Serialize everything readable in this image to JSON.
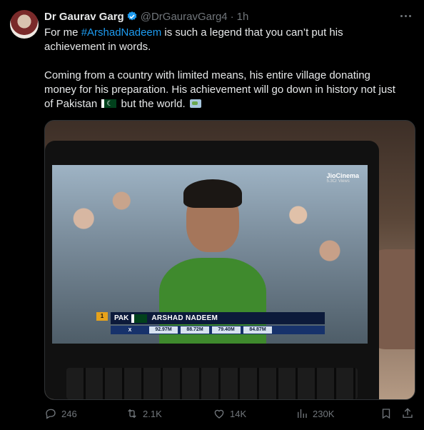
{
  "author": {
    "name": "Dr Gaurav Garg",
    "handle": "@DrGauravGarg4",
    "time": "1h"
  },
  "tweet": {
    "line1_before": "For me ",
    "hashtag": "#ArshadNadeem",
    "line1_after": " is such a legend that you can’t put his achievement in words.",
    "para2_before": "Coming from a country with limited means, his entire village donating money for his preparation. His achievement will go down in history not just of Pakistan ",
    "para2_mid": " but the world. "
  },
  "media": {
    "broadcaster": "JioCinema",
    "broadcaster_sub": "5.3Cr Views",
    "rank": "1",
    "country_code": "PAK",
    "athlete_name": "ARSHAD NADEEM",
    "scores": [
      "X",
      "92.97M",
      "88.72M",
      "79.40M",
      "84.87M"
    ]
  },
  "actions": {
    "replies": "246",
    "reposts": "2.1K",
    "likes": "14K",
    "views": "230K"
  },
  "icons": [
    "verified-badge-icon",
    "more-icon",
    "pakistan-flag-icon",
    "world-map-icon",
    "reply-icon",
    "repost-icon",
    "like-icon",
    "views-icon",
    "bookmark-icon",
    "share-icon"
  ],
  "colors": {
    "accent": "#1d9bf0",
    "muted": "#71767b",
    "text": "#e7e9ea",
    "background": "#000000"
  }
}
